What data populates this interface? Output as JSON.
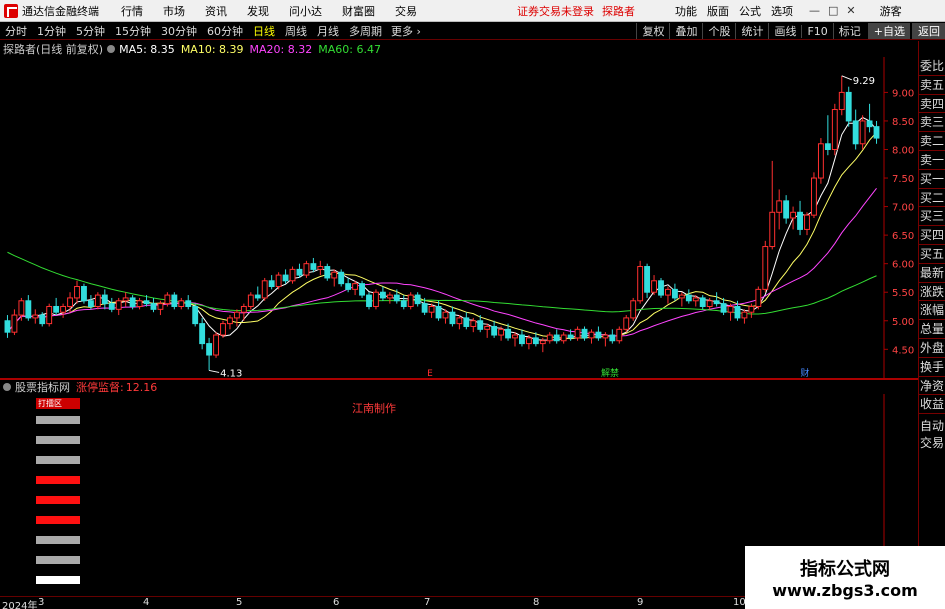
{
  "window": {
    "app_title": "通达信金融终端",
    "menu": [
      "行情",
      "市场",
      "资讯",
      "发现",
      "问小达",
      "财富圈",
      "交易"
    ],
    "login_status": "证券交易未登录",
    "username": "探路者",
    "right_menu": [
      "功能",
      "版面",
      "公式",
      "选项"
    ],
    "guest": "游客"
  },
  "toolbar": {
    "periods": [
      "分时",
      "1分钟",
      "5分钟",
      "15分钟",
      "30分钟",
      "60分钟",
      "日线",
      "周线",
      "月线",
      "多周期"
    ],
    "active_period": "日线",
    "more": "更多 ›",
    "right_tools": [
      "复权",
      "叠加",
      "个股",
      "统计",
      "画线",
      "F10",
      "标记",
      "+自选",
      "返回"
    ]
  },
  "chart_header": {
    "stock": "探路者(日线 前复权)",
    "ma": [
      {
        "label": "MA5: 8.35",
        "color": "#ffffff"
      },
      {
        "label": "MA10: 8.39",
        "color": "#ffff66"
      },
      {
        "label": "MA20: 8.32",
        "color": "#ff44ff"
      },
      {
        "label": "MA60: 6.47",
        "color": "#33dd33"
      }
    ]
  },
  "side_panel": [
    "委比",
    "卖五",
    "卖四",
    "卖三",
    "卖二",
    "卖一",
    "买一",
    "买二",
    "买三",
    "买四",
    "买五",
    "最新",
    "涨跌",
    "涨幅",
    "总量",
    "外盘",
    "换手",
    "净资",
    "收益"
  ],
  "side_panel_bottom": [
    "自动",
    "交易"
  ],
  "chart_data": {
    "type": "candlestick",
    "y_ticks": [
      4.5,
      5.0,
      5.5,
      6.0,
      6.5,
      7.0,
      7.5,
      8.0,
      8.5,
      9.0
    ],
    "ylim": [
      4.05,
      9.55
    ],
    "annotations": [
      {
        "text": "9.29",
        "kind": "high"
      },
      {
        "text": "4.13",
        "kind": "low"
      }
    ],
    "event_markers": [
      "E",
      "解禁",
      "财"
    ],
    "x_ticks": [
      "2024年",
      "3",
      "4",
      "5",
      "6",
      "7",
      "8",
      "9",
      "10"
    ],
    "candles_ohlc": [
      [
        5.0,
        5.1,
        4.7,
        4.8
      ],
      [
        4.8,
        5.2,
        4.75,
        5.1
      ],
      [
        5.1,
        5.4,
        5.0,
        5.35
      ],
      [
        5.35,
        5.45,
        5.0,
        5.05
      ],
      [
        5.05,
        5.2,
        4.95,
        5.1
      ],
      [
        5.1,
        5.15,
        4.9,
        4.95
      ],
      [
        4.95,
        5.3,
        4.9,
        5.25
      ],
      [
        5.25,
        5.4,
        5.1,
        5.15
      ],
      [
        5.15,
        5.3,
        5.05,
        5.25
      ],
      [
        5.25,
        5.5,
        5.15,
        5.4
      ],
      [
        5.4,
        5.7,
        5.3,
        5.6
      ],
      [
        5.6,
        5.65,
        5.3,
        5.35
      ],
      [
        5.35,
        5.45,
        5.2,
        5.25
      ],
      [
        5.25,
        5.5,
        5.2,
        5.45
      ],
      [
        5.45,
        5.55,
        5.2,
        5.3
      ],
      [
        5.3,
        5.4,
        5.15,
        5.2
      ],
      [
        5.2,
        5.4,
        5.1,
        5.35
      ],
      [
        5.35,
        5.5,
        5.25,
        5.4
      ],
      [
        5.4,
        5.45,
        5.2,
        5.25
      ],
      [
        5.25,
        5.4,
        5.2,
        5.35
      ],
      [
        5.35,
        5.45,
        5.25,
        5.3
      ],
      [
        5.3,
        5.4,
        5.15,
        5.2
      ],
      [
        5.2,
        5.35,
        5.1,
        5.3
      ],
      [
        5.3,
        5.5,
        5.25,
        5.45
      ],
      [
        5.45,
        5.5,
        5.2,
        5.25
      ],
      [
        5.25,
        5.4,
        5.2,
        5.35
      ],
      [
        5.35,
        5.45,
        5.2,
        5.25
      ],
      [
        5.25,
        5.3,
        4.9,
        4.95
      ],
      [
        4.95,
        5.05,
        4.5,
        4.6
      ],
      [
        4.6,
        4.7,
        4.13,
        4.4
      ],
      [
        4.4,
        4.8,
        4.35,
        4.75
      ],
      [
        4.75,
        5.0,
        4.7,
        4.95
      ],
      [
        4.95,
        5.1,
        4.85,
        5.05
      ],
      [
        5.05,
        5.2,
        4.9,
        5.15
      ],
      [
        5.15,
        5.3,
        5.0,
        5.25
      ],
      [
        5.25,
        5.5,
        5.2,
        5.45
      ],
      [
        5.45,
        5.6,
        5.35,
        5.4
      ],
      [
        5.4,
        5.75,
        5.35,
        5.7
      ],
      [
        5.7,
        5.8,
        5.55,
        5.6
      ],
      [
        5.6,
        5.85,
        5.55,
        5.8
      ],
      [
        5.8,
        5.9,
        5.65,
        5.7
      ],
      [
        5.7,
        5.95,
        5.65,
        5.9
      ],
      [
        5.9,
        6.0,
        5.75,
        5.8
      ],
      [
        5.8,
        6.05,
        5.75,
        6.0
      ],
      [
        6.0,
        6.1,
        5.85,
        5.9
      ],
      [
        5.9,
        6.05,
        5.8,
        5.95
      ],
      [
        5.95,
        6.0,
        5.7,
        5.75
      ],
      [
        5.75,
        5.9,
        5.6,
        5.85
      ],
      [
        5.85,
        5.9,
        5.6,
        5.65
      ],
      [
        5.65,
        5.75,
        5.5,
        5.55
      ],
      [
        5.55,
        5.7,
        5.45,
        5.65
      ],
      [
        5.65,
        5.7,
        5.4,
        5.45
      ],
      [
        5.45,
        5.5,
        5.2,
        5.25
      ],
      [
        5.25,
        5.55,
        5.2,
        5.5
      ],
      [
        5.5,
        5.6,
        5.35,
        5.4
      ],
      [
        5.4,
        5.5,
        5.3,
        5.45
      ],
      [
        5.45,
        5.55,
        5.3,
        5.35
      ],
      [
        5.35,
        5.45,
        5.2,
        5.25
      ],
      [
        5.25,
        5.5,
        5.2,
        5.45
      ],
      [
        5.45,
        5.5,
        5.25,
        5.3
      ],
      [
        5.3,
        5.4,
        5.1,
        5.15
      ],
      [
        5.15,
        5.3,
        5.05,
        5.25
      ],
      [
        5.25,
        5.35,
        5.0,
        5.05
      ],
      [
        5.05,
        5.2,
        4.95,
        5.15
      ],
      [
        5.15,
        5.25,
        4.9,
        4.95
      ],
      [
        4.95,
        5.1,
        4.85,
        5.05
      ],
      [
        5.05,
        5.15,
        4.85,
        4.9
      ],
      [
        4.9,
        5.05,
        4.8,
        5.0
      ],
      [
        5.0,
        5.1,
        4.8,
        4.85
      ],
      [
        4.85,
        4.95,
        4.7,
        4.9
      ],
      [
        4.9,
        5.0,
        4.7,
        4.75
      ],
      [
        4.75,
        4.9,
        4.65,
        4.85
      ],
      [
        4.85,
        4.95,
        4.65,
        4.7
      ],
      [
        4.7,
        4.8,
        4.55,
        4.75
      ],
      [
        4.75,
        4.85,
        4.55,
        4.6
      ],
      [
        4.6,
        4.75,
        4.5,
        4.7
      ],
      [
        4.7,
        4.8,
        4.55,
        4.6
      ],
      [
        4.6,
        4.7,
        4.45,
        4.65
      ],
      [
        4.65,
        4.8,
        4.6,
        4.75
      ],
      [
        4.75,
        4.85,
        4.6,
        4.65
      ],
      [
        4.65,
        4.8,
        4.6,
        4.75
      ],
      [
        4.75,
        4.85,
        4.65,
        4.7
      ],
      [
        4.7,
        4.9,
        4.65,
        4.85
      ],
      [
        4.85,
        4.9,
        4.65,
        4.7
      ],
      [
        4.7,
        4.85,
        4.6,
        4.8
      ],
      [
        4.8,
        4.9,
        4.65,
        4.7
      ],
      [
        4.7,
        4.8,
        4.55,
        4.75
      ],
      [
        4.75,
        4.85,
        4.6,
        4.65
      ],
      [
        4.65,
        4.9,
        4.6,
        4.85
      ],
      [
        4.85,
        5.1,
        4.8,
        5.05
      ],
      [
        5.05,
        5.4,
        5.0,
        5.35
      ],
      [
        5.35,
        6.05,
        5.3,
        5.95
      ],
      [
        5.95,
        6.0,
        5.4,
        5.5
      ],
      [
        5.5,
        5.8,
        5.45,
        5.7
      ],
      [
        5.7,
        5.75,
        5.4,
        5.45
      ],
      [
        5.45,
        5.6,
        5.3,
        5.55
      ],
      [
        5.55,
        5.65,
        5.35,
        5.4
      ],
      [
        5.4,
        5.5,
        5.25,
        5.45
      ],
      [
        5.45,
        5.55,
        5.3,
        5.35
      ],
      [
        5.35,
        5.45,
        5.25,
        5.4
      ],
      [
        5.4,
        5.45,
        5.2,
        5.25
      ],
      [
        5.25,
        5.4,
        5.2,
        5.35
      ],
      [
        5.35,
        5.5,
        5.25,
        5.3
      ],
      [
        5.3,
        5.4,
        5.1,
        5.15
      ],
      [
        5.15,
        5.3,
        5.0,
        5.25
      ],
      [
        5.25,
        5.35,
        5.0,
        5.05
      ],
      [
        5.05,
        5.2,
        4.95,
        5.15
      ],
      [
        5.15,
        5.3,
        5.05,
        5.25
      ],
      [
        5.25,
        5.6,
        5.2,
        5.55
      ],
      [
        5.55,
        6.4,
        5.5,
        6.3
      ],
      [
        6.3,
        7.8,
        6.25,
        6.9
      ],
      [
        6.9,
        7.3,
        6.6,
        7.1
      ],
      [
        7.1,
        7.2,
        6.7,
        6.8
      ],
      [
        6.8,
        7.0,
        6.6,
        6.9
      ],
      [
        6.9,
        7.1,
        6.5,
        6.6
      ],
      [
        6.6,
        6.9,
        6.5,
        6.85
      ],
      [
        6.85,
        7.6,
        6.8,
        7.5
      ],
      [
        7.5,
        8.2,
        7.4,
        8.1
      ],
      [
        8.1,
        8.6,
        7.9,
        8.0
      ],
      [
        8.0,
        8.8,
        7.9,
        8.7
      ],
      [
        8.7,
        9.29,
        8.6,
        9.0
      ],
      [
        9.0,
        9.1,
        8.4,
        8.5
      ],
      [
        8.5,
        8.7,
        8.0,
        8.1
      ],
      [
        8.1,
        8.6,
        8.0,
        8.5
      ],
      [
        8.5,
        8.8,
        8.3,
        8.4
      ],
      [
        8.4,
        8.5,
        8.1,
        8.2
      ]
    ]
  },
  "indicator": {
    "name": "股票指标网",
    "label": "涨停监督:",
    "value": "12.16",
    "author": "江南制作",
    "badge": "打擂区",
    "bars": [
      "#aaaaaa",
      "#aaaaaa",
      "#aaaaaa",
      "#ff1111",
      "#ff1111",
      "#ff1111",
      "#aaaaaa",
      "#aaaaaa",
      "#ffffff",
      "#ffffff"
    ]
  },
  "watermark": {
    "title": "指标公式网",
    "url": "www.zbgs3.com"
  }
}
